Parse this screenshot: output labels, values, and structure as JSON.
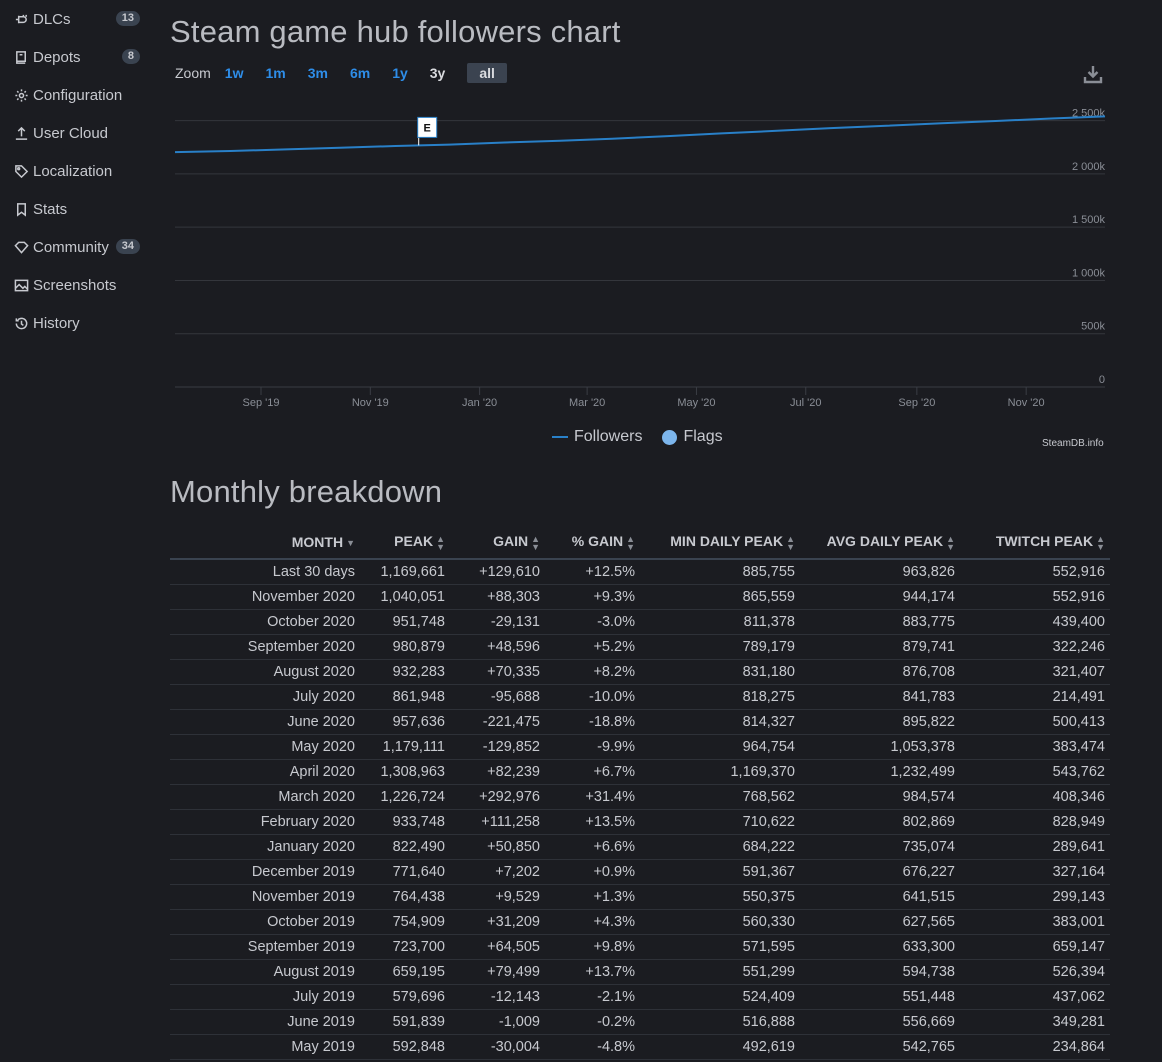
{
  "sidebar": {
    "items": [
      {
        "label": "DLCs",
        "icon": "plug-icon",
        "badge": "13"
      },
      {
        "label": "Depots",
        "icon": "depot-icon",
        "badge": "8"
      },
      {
        "label": "Configuration",
        "icon": "gear-icon",
        "badge": ""
      },
      {
        "label": "User Cloud",
        "icon": "upload-icon",
        "badge": ""
      },
      {
        "label": "Localization",
        "icon": "tag-icon",
        "badge": ""
      },
      {
        "label": "Stats",
        "icon": "bookmark-icon",
        "badge": ""
      },
      {
        "label": "Community",
        "icon": "diamond-icon",
        "badge": "34"
      },
      {
        "label": "Screenshots",
        "icon": "image-icon",
        "badge": ""
      },
      {
        "label": "History",
        "icon": "history-icon",
        "badge": ""
      }
    ]
  },
  "chart_section": {
    "title": "Steam game hub followers chart",
    "zoom_label": "Zoom",
    "zoom_options": [
      "1w",
      "1m",
      "3m",
      "6m",
      "1y",
      "3y",
      "all"
    ],
    "active_zoom": "all",
    "legend": {
      "followers": "Followers",
      "flags": "Flags"
    },
    "credit": "SteamDB.info",
    "flag_marker": "E",
    "colors": {
      "line": "#2980c8",
      "flags": "#7cb5ec",
      "link": "#2e8de8"
    }
  },
  "chart_data": {
    "type": "line",
    "series": [
      {
        "name": "Followers",
        "x": [
          "2019-07-15",
          "2019-08-15",
          "2019-09-15",
          "2019-10-15",
          "2019-11-15",
          "2019-12-15",
          "2020-01-15",
          "2020-02-15",
          "2020-03-15",
          "2020-04-15",
          "2020-05-15",
          "2020-06-15",
          "2020-07-15",
          "2020-08-15",
          "2020-09-15",
          "2020-10-15",
          "2020-11-15",
          "2020-12-15"
        ],
        "y": [
          2205000,
          2215000,
          2230000,
          2245000,
          2262000,
          2275000,
          2295000,
          2312000,
          2330000,
          2355000,
          2380000,
          2405000,
          2430000,
          2452000,
          2475000,
          2497000,
          2520000,
          2540000
        ]
      }
    ],
    "flags": [
      {
        "x": "2019-11-28",
        "label": "E"
      }
    ],
    "x_ticks": [
      "Sep '19",
      "Nov '19",
      "Jan '20",
      "Mar '20",
      "May '20",
      "Jul '20",
      "Sep '20",
      "Nov '20"
    ],
    "x_tick_dates": [
      "2019-09-01",
      "2019-11-01",
      "2020-01-01",
      "2020-03-01",
      "2020-05-01",
      "2020-07-01",
      "2020-09-01",
      "2020-11-01"
    ],
    "y_ticks": [
      "0",
      "500k",
      "1 000k",
      "1 500k",
      "2 000k",
      "2 500k"
    ],
    "y_tick_values": [
      0,
      500000,
      1000000,
      1500000,
      2000000,
      2500000
    ],
    "ylim": [
      0,
      2750000
    ],
    "xlim": [
      "2019-07-15",
      "2020-12-15"
    ],
    "grid": true,
    "legend_position": "bottom-center"
  },
  "breakdown": {
    "title": "Monthly breakdown",
    "columns": [
      "MONTH",
      "PEAK",
      "GAIN",
      "% GAIN",
      "MIN DAILY PEAK",
      "AVG DAILY PEAK",
      "TWITCH PEAK"
    ],
    "rows": [
      [
        "Last 30 days",
        "1,169,661",
        "+129,610",
        "+12.5%",
        "885,755",
        "963,826",
        "552,916"
      ],
      [
        "November 2020",
        "1,040,051",
        "+88,303",
        "+9.3%",
        "865,559",
        "944,174",
        "552,916"
      ],
      [
        "October 2020",
        "951,748",
        "-29,131",
        "-3.0%",
        "811,378",
        "883,775",
        "439,400"
      ],
      [
        "September 2020",
        "980,879",
        "+48,596",
        "+5.2%",
        "789,179",
        "879,741",
        "322,246"
      ],
      [
        "August 2020",
        "932,283",
        "+70,335",
        "+8.2%",
        "831,180",
        "876,708",
        "321,407"
      ],
      [
        "July 2020",
        "861,948",
        "-95,688",
        "-10.0%",
        "818,275",
        "841,783",
        "214,491"
      ],
      [
        "June 2020",
        "957,636",
        "-221,475",
        "-18.8%",
        "814,327",
        "895,822",
        "500,413"
      ],
      [
        "May 2020",
        "1,179,111",
        "-129,852",
        "-9.9%",
        "964,754",
        "1,053,378",
        "383,474"
      ],
      [
        "April 2020",
        "1,308,963",
        "+82,239",
        "+6.7%",
        "1,169,370",
        "1,232,499",
        "543,762"
      ],
      [
        "March 2020",
        "1,226,724",
        "+292,976",
        "+31.4%",
        "768,562",
        "984,574",
        "408,346"
      ],
      [
        "February 2020",
        "933,748",
        "+111,258",
        "+13.5%",
        "710,622",
        "802,869",
        "828,949"
      ],
      [
        "January 2020",
        "822,490",
        "+50,850",
        "+6.6%",
        "684,222",
        "735,074",
        "289,641"
      ],
      [
        "December 2019",
        "771,640",
        "+7,202",
        "+0.9%",
        "591,367",
        "676,227",
        "327,164"
      ],
      [
        "November 2019",
        "764,438",
        "+9,529",
        "+1.3%",
        "550,375",
        "641,515",
        "299,143"
      ],
      [
        "October 2019",
        "754,909",
        "+31,209",
        "+4.3%",
        "560,330",
        "627,565",
        "383,001"
      ],
      [
        "September 2019",
        "723,700",
        "+64,505",
        "+9.8%",
        "571,595",
        "633,300",
        "659,147"
      ],
      [
        "August 2019",
        "659,195",
        "+79,499",
        "+13.7%",
        "551,299",
        "594,738",
        "526,394"
      ],
      [
        "July 2019",
        "579,696",
        "-12,143",
        "-2.1%",
        "524,409",
        "551,448",
        "437,062"
      ],
      [
        "June 2019",
        "591,839",
        "-1,009",
        "-0.2%",
        "516,888",
        "556,669",
        "349,281"
      ],
      [
        "May 2019",
        "592,848",
        "-30,004",
        "-4.8%",
        "492,619",
        "542,765",
        "234,864"
      ]
    ],
    "colors": {
      "positive": "#65c23a",
      "negative": "#e23a3a"
    }
  }
}
